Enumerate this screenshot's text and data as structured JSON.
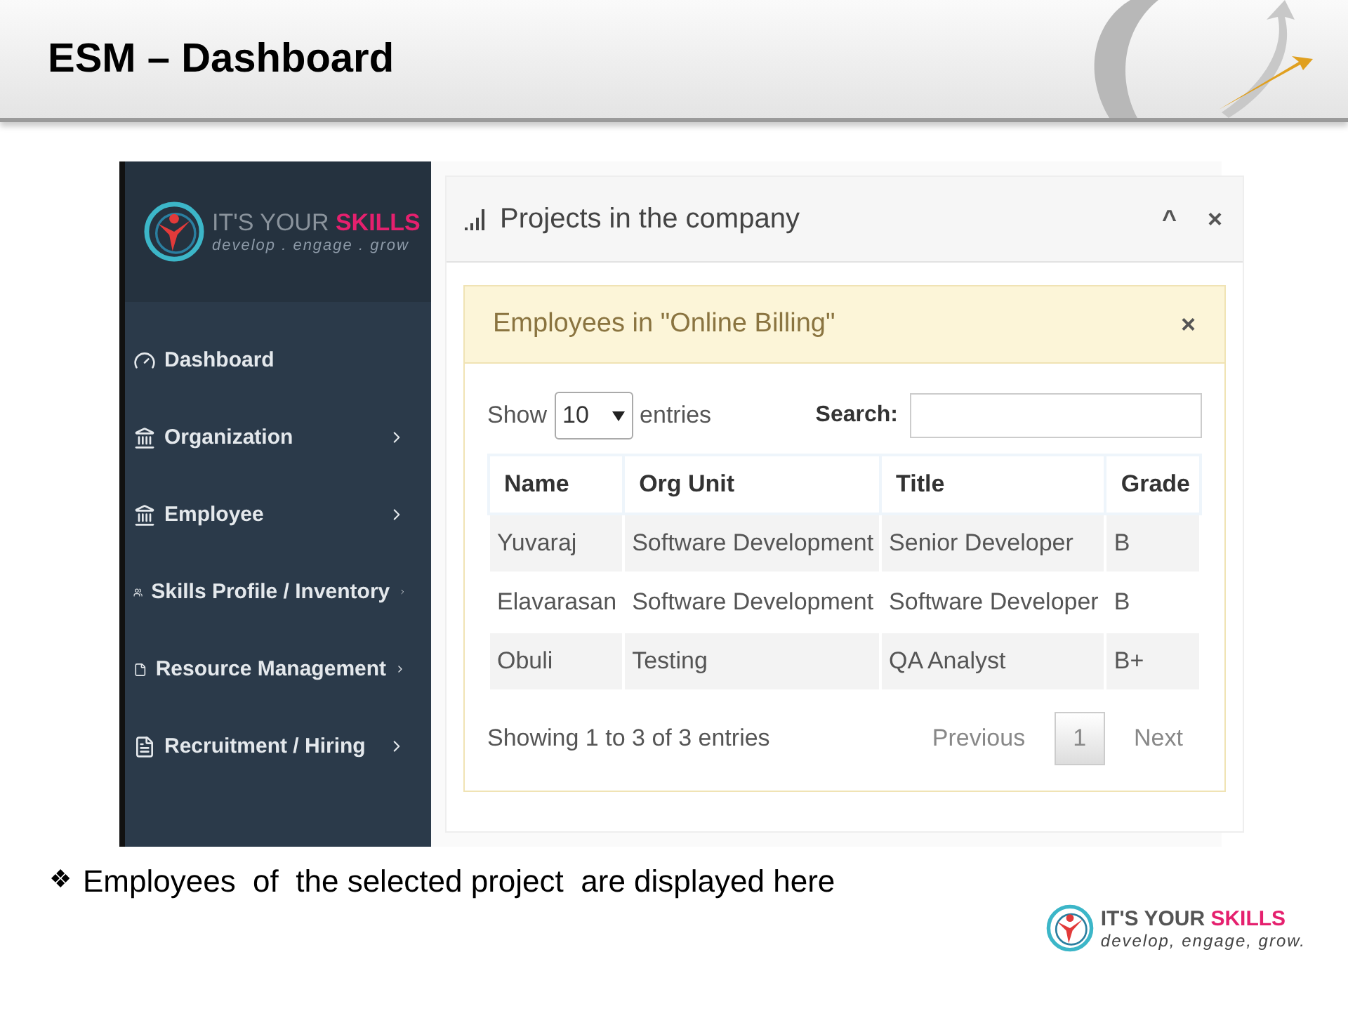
{
  "slide": {
    "title": "ESM – Dashboard",
    "bullet": "Employees  of  the selected project  are displayed here",
    "bullet_marker": "❖"
  },
  "app": {
    "logo": {
      "name_a": "IT'S YOUR ",
      "name_b": "SKILLS",
      "tagline": "develop . engage . grow"
    },
    "sidebar": {
      "items": [
        {
          "label": "Dashboard",
          "has_submenu": false
        },
        {
          "label": "Organization",
          "has_submenu": true
        },
        {
          "label": "Employee",
          "has_submenu": true
        },
        {
          "label": "Skills Profile / Inventory",
          "has_submenu": true
        },
        {
          "label": "Resource Management",
          "has_submenu": true
        },
        {
          "label": "Recruitment / Hiring",
          "has_submenu": true
        }
      ]
    },
    "panel": {
      "title": "Projects in the company",
      "collapse": "^",
      "close": "×",
      "modal": {
        "title": "Employees in \"Online Billing\"",
        "close": "×",
        "length": {
          "before": "Show",
          "value": "10",
          "after": "entries"
        },
        "search": {
          "label": "Search:"
        },
        "table": {
          "columns": [
            "Name",
            "Org Unit",
            "Title",
            "Grade"
          ],
          "rows": [
            [
              "Yuvaraj",
              "Software Development",
              "Senior Developer",
              "B"
            ],
            [
              "Elavarasan",
              "Software Development",
              "Software Developer",
              "B"
            ],
            [
              "Obuli",
              "Testing",
              "QA Analyst",
              "B+"
            ]
          ]
        },
        "info": "Showing 1 to 3 of 3 entries",
        "pagination": [
          {
            "label": "Previous",
            "selected": false
          },
          {
            "label": "1",
            "selected": true
          },
          {
            "label": "Next",
            "selected": false
          }
        ]
      }
    }
  },
  "footer_logo": {
    "name_a": "IT'S YOUR ",
    "name_b": "SKILLS",
    "tagline": "develop, engage, grow."
  }
}
